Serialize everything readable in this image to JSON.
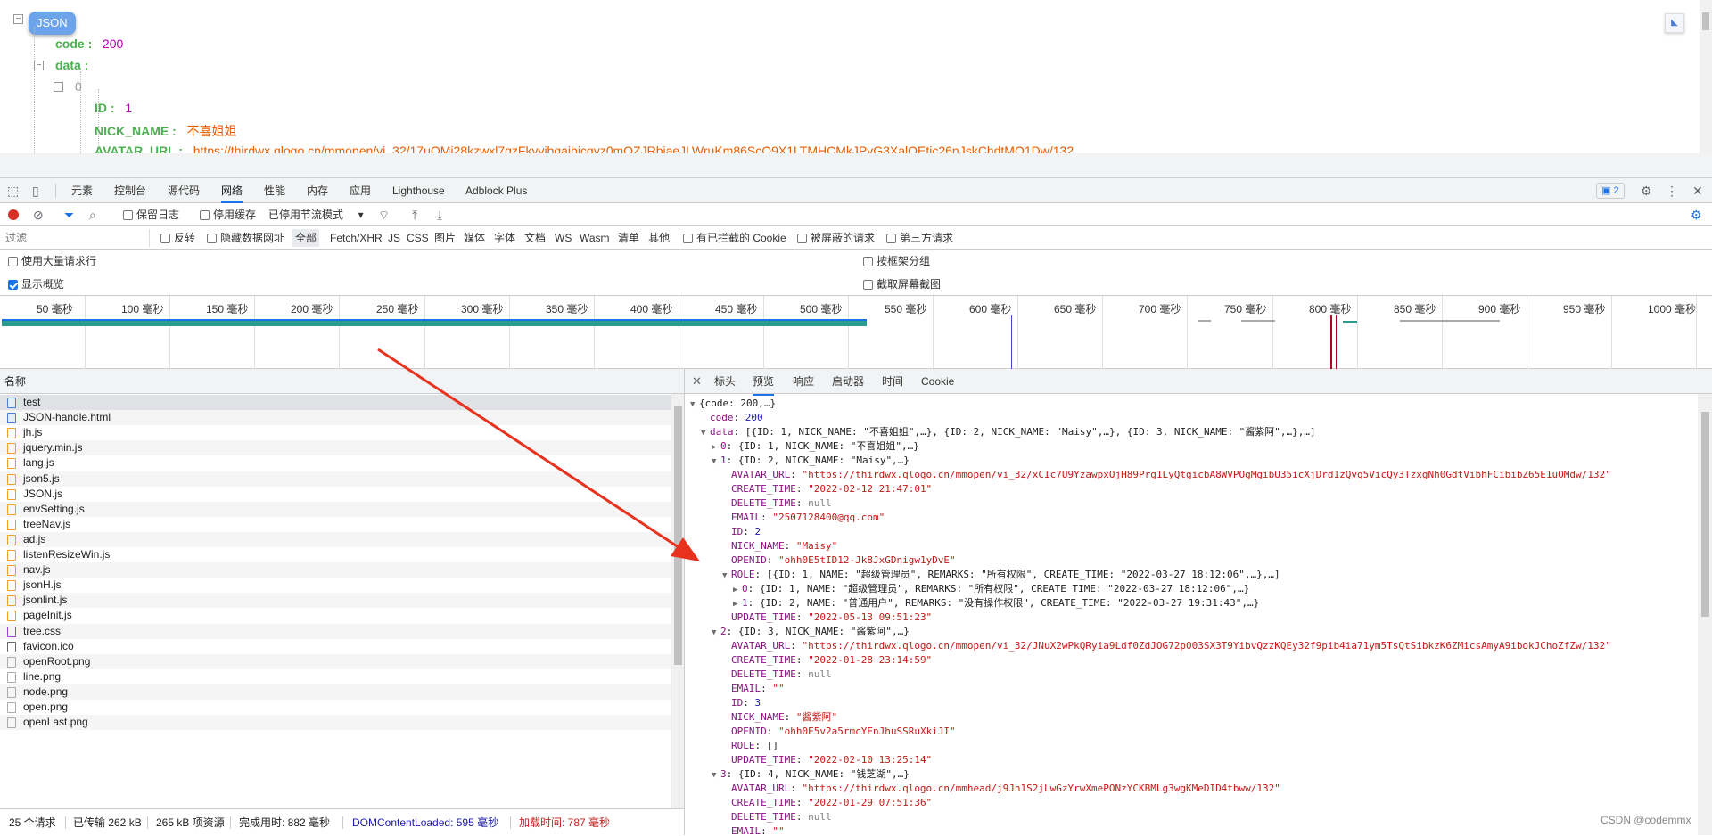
{
  "page": {
    "json_button": "JSON",
    "tree_lines": [
      {
        "key": "code :",
        "value": "200",
        "vtype": "num"
      },
      {
        "key": "data :",
        "value": "",
        "vtype": "none"
      },
      {
        "key": "",
        "value": "0",
        "vtype": "gray"
      },
      {
        "key": "ID :",
        "value": "1",
        "vtype": "num"
      },
      {
        "key": "NICK_NAME :",
        "value": "不喜姐姐",
        "vtype": "str"
      },
      {
        "key": "AVATAR_URL :",
        "value": "https://thirdwx.qlogo.cn/mmopen/vi_32/17uOMj28kzwxl7qzFkvvibgaibicgyz0mOZJRbiaeJLWruKm86ScO9X1LTMHCMkJPvG3XalOEtic26nJskChdtMO1Dw/132",
        "vtype": "str"
      }
    ]
  },
  "devtools": {
    "tabs": [
      "元素",
      "控制台",
      "源代码",
      "网络",
      "性能",
      "内存",
      "应用",
      "Lighthouse",
      "Adblock Plus"
    ],
    "active_tab": "网络",
    "issues_badge": "2",
    "toolbar": {
      "preserve_log": "保留日志",
      "disable_cache": "停用缓存",
      "throttle": "已停用节流模式"
    },
    "filter": {
      "placeholder": "过滤",
      "invert": "反转",
      "hide_data_urls": "隐藏数据网址",
      "types": [
        "全部",
        "Fetch/XHR",
        "JS",
        "CSS",
        "图片",
        "媒体",
        "字体",
        "文档",
        "WS",
        "Wasm",
        "清单",
        "其他"
      ],
      "blocked_cookies": "有已拦截的 Cookie",
      "blocked_requests": "被屏蔽的请求",
      "third_party": "第三方请求"
    },
    "options": {
      "large_rows": "使用大量请求行",
      "show_overview": "显示概览",
      "group_by_frame": "按框架分组",
      "capture_screenshots": "截取屏幕截图"
    },
    "timeline_ticks": [
      "50 毫秒",
      "100 毫秒",
      "150 毫秒",
      "200 毫秒",
      "250 毫秒",
      "300 毫秒",
      "350 毫秒",
      "400 毫秒",
      "450 毫秒",
      "500 毫秒",
      "550 毫秒",
      "600 毫秒",
      "650 毫秒",
      "700 毫秒",
      "750 毫秒",
      "800 毫秒",
      "850 毫秒",
      "900 毫秒",
      "950 毫秒",
      "1000 毫秒"
    ],
    "list_header": "名称",
    "requests": [
      {
        "name": "test",
        "kind": "doc"
      },
      {
        "name": "JSON-handle.html",
        "kind": "doc"
      },
      {
        "name": "jh.js",
        "kind": "js"
      },
      {
        "name": "jquery.min.js",
        "kind": "js"
      },
      {
        "name": "lang.js",
        "kind": "js"
      },
      {
        "name": "json5.js",
        "kind": "js"
      },
      {
        "name": "JSON.js",
        "kind": "js"
      },
      {
        "name": "envSetting.js",
        "kind": "js"
      },
      {
        "name": "treeNav.js",
        "kind": "js"
      },
      {
        "name": "ad.js",
        "kind": "js"
      },
      {
        "name": "listenResizeWin.js",
        "kind": "js"
      },
      {
        "name": "nav.js",
        "kind": "js"
      },
      {
        "name": "jsonH.js",
        "kind": "js"
      },
      {
        "name": "jsonlint.js",
        "kind": "js"
      },
      {
        "name": "pageInit.js",
        "kind": "js"
      },
      {
        "name": "tree.css",
        "kind": "css"
      },
      {
        "name": "favicon.ico",
        "kind": "ico"
      },
      {
        "name": "openRoot.png",
        "kind": "img"
      },
      {
        "name": "line.png",
        "kind": "img"
      },
      {
        "name": "node.png",
        "kind": "img"
      },
      {
        "name": "open.png",
        "kind": "img"
      },
      {
        "name": "openLast.png",
        "kind": "img"
      }
    ],
    "status": {
      "requests": "25 个请求",
      "transferred": "已传输 262 kB",
      "resources": "265 kB 项资源",
      "finish": "完成用时: 882 毫秒",
      "dcl": "DOMContentLoaded: 595 毫秒",
      "load": "加载时间: 787 毫秒"
    },
    "detail_tabs": [
      "标头",
      "预览",
      "响应",
      "启动器",
      "时间",
      "Cookie"
    ],
    "active_detail_tab": "预览",
    "preview_lines": [
      {
        "indent": 0,
        "arrow": "▼",
        "text": "{code: 200,…}",
        "cls": "pv"
      },
      {
        "indent": 1,
        "arrow": "",
        "key": "code",
        "text": "200",
        "cls": "pnum"
      },
      {
        "indent": 1,
        "arrow": "▼",
        "key": "data",
        "text": "[{ID: 1, NICK_NAME: \"不喜姐姐\",…}, {ID: 2, NICK_NAME: \"Maisy\",…}, {ID: 3, NICK_NAME: \"酱紫阿\",…},…]",
        "cls": "pv"
      },
      {
        "indent": 2,
        "arrow": "▶",
        "key": "0",
        "text": "{ID: 1, NICK_NAME: \"不喜姐姐\",…}",
        "cls": "pv"
      },
      {
        "indent": 2,
        "arrow": "▼",
        "key": "1",
        "text": "{ID: 2, NICK_NAME: \"Maisy\",…}",
        "cls": "pv"
      },
      {
        "indent": 3,
        "arrow": "",
        "key": "AVATAR_URL",
        "text": "\"https://thirdwx.qlogo.cn/mmopen/vi_32/xCIc7U9YzawpxOjH89Prg1LyQtgicbA8WVPOgMgibU35icXjDrd1zQvq5VicQy3TzxgNh0GdtVibhFCibibZ65E1uOMdw/132\"",
        "cls": "pstr"
      },
      {
        "indent": 3,
        "arrow": "",
        "key": "CREATE_TIME",
        "text": "\"2022-02-12 21:47:01\"",
        "cls": "pstr"
      },
      {
        "indent": 3,
        "arrow": "",
        "key": "DELETE_TIME",
        "text": "null",
        "cls": "pnull"
      },
      {
        "indent": 3,
        "arrow": "",
        "key": "EMAIL",
        "text": "\"2507128400@qq.com\"",
        "cls": "pstr"
      },
      {
        "indent": 3,
        "arrow": "",
        "key": "ID",
        "text": "2",
        "cls": "pnum"
      },
      {
        "indent": 3,
        "arrow": "",
        "key": "NICK_NAME",
        "text": "\"Maisy\"",
        "cls": "pstr"
      },
      {
        "indent": 3,
        "arrow": "",
        "key": "OPENID",
        "text": "\"ohh0E5tID12-Jk8JxGDnigw1yDvE\"",
        "cls": "pstr"
      },
      {
        "indent": 3,
        "arrow": "▼",
        "key": "ROLE",
        "text": "[{ID: 1, NAME: \"超级管理员\", REMARKS: \"所有权限\", CREATE_TIME: \"2022-03-27 18:12:06\",…},…]",
        "cls": "pv"
      },
      {
        "indent": 4,
        "arrow": "▶",
        "key": "0",
        "text": "{ID: 1, NAME: \"超级管理员\", REMARKS: \"所有权限\", CREATE_TIME: \"2022-03-27 18:12:06\",…}",
        "cls": "pv"
      },
      {
        "indent": 4,
        "arrow": "▶",
        "key": "1",
        "text": "{ID: 2, NAME: \"普通用户\", REMARKS: \"没有操作权限\", CREATE_TIME: \"2022-03-27 19:31:43\",…}",
        "cls": "pv"
      },
      {
        "indent": 3,
        "arrow": "",
        "key": "UPDATE_TIME",
        "text": "\"2022-05-13 09:51:23\"",
        "cls": "pstr"
      },
      {
        "indent": 2,
        "arrow": "▼",
        "key": "2",
        "text": "{ID: 3, NICK_NAME: \"酱紫阿\",…}",
        "cls": "pv"
      },
      {
        "indent": 3,
        "arrow": "",
        "key": "AVATAR_URL",
        "text": "\"https://thirdwx.qlogo.cn/mmopen/vi_32/JNuX2wPkQRyia9Ldf0ZdJOG72p003SX3T9YibvQzzKQEy32f9pib4ia71ym5TsQtSibkzK6ZMicsAmyA9ibokJChoZfZw/132\"",
        "cls": "pstr"
      },
      {
        "indent": 3,
        "arrow": "",
        "key": "CREATE_TIME",
        "text": "\"2022-01-28 23:14:59\"",
        "cls": "pstr"
      },
      {
        "indent": 3,
        "arrow": "",
        "key": "DELETE_TIME",
        "text": "null",
        "cls": "pnull"
      },
      {
        "indent": 3,
        "arrow": "",
        "key": "EMAIL",
        "text": "\"\"",
        "cls": "pstr"
      },
      {
        "indent": 3,
        "arrow": "",
        "key": "ID",
        "text": "3",
        "cls": "pnum"
      },
      {
        "indent": 3,
        "arrow": "",
        "key": "NICK_NAME",
        "text": "\"酱紫阿\"",
        "cls": "pstr"
      },
      {
        "indent": 3,
        "arrow": "",
        "key": "OPENID",
        "text": "\"ohh0E5v2a5rmcYEnJhuSSRuXkiJI\"",
        "cls": "pstr"
      },
      {
        "indent": 3,
        "arrow": "",
        "key": "ROLE",
        "text": "[]",
        "cls": "pv"
      },
      {
        "indent": 3,
        "arrow": "",
        "key": "UPDATE_TIME",
        "text": "\"2022-02-10 13:25:14\"",
        "cls": "pstr"
      },
      {
        "indent": 2,
        "arrow": "▼",
        "key": "3",
        "text": "{ID: 4, NICK_NAME: \"钱芝湖\",…}",
        "cls": "pv"
      },
      {
        "indent": 3,
        "arrow": "",
        "key": "AVATAR_URL",
        "text": "\"https://thirdwx.qlogo.cn/mmhead/j9Jn1S2jLwGzYrwXmePONzYCKBMLg3wgKMeDID4tbww/132\"",
        "cls": "pstr"
      },
      {
        "indent": 3,
        "arrow": "",
        "key": "CREATE_TIME",
        "text": "\"2022-01-29 07:51:36\"",
        "cls": "pstr"
      },
      {
        "indent": 3,
        "arrow": "",
        "key": "DELETE_TIME",
        "text": "null",
        "cls": "pnull"
      },
      {
        "indent": 3,
        "arrow": "",
        "key": "EMAIL",
        "text": "\"\"",
        "cls": "pstr"
      }
    ],
    "watermark": "CSDN @codemmx"
  },
  "colors": {
    "accent": "#1a73e8",
    "json_pill": "#6da3e8",
    "arrow": "#e8321e",
    "waterfall_bar": "#2a9d8f"
  }
}
